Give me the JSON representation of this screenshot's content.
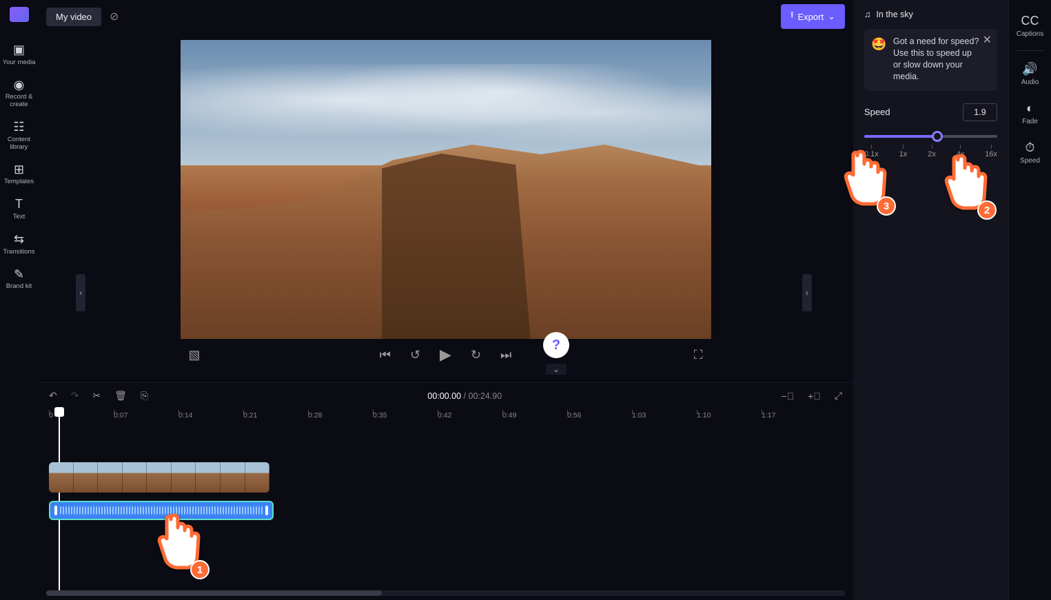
{
  "header": {
    "title": "My video",
    "export_label": "Export"
  },
  "left_nav": [
    {
      "label": "Your media"
    },
    {
      "label": "Record & create"
    },
    {
      "label": "Content library"
    },
    {
      "label": "Templates"
    },
    {
      "label": "Text"
    },
    {
      "label": "Transitions"
    },
    {
      "label": "Brand kit"
    }
  ],
  "preview": {
    "aspect_ratio": "16:9"
  },
  "transport": {
    "current_time": "00:00.00",
    "duration": "00:24.90"
  },
  "ruler_ticks": [
    "0",
    "0:07",
    "0:14",
    "0:21",
    "0:28",
    "0:35",
    "0:42",
    "0:49",
    "0:56",
    "1:03",
    "1:10",
    "1:17"
  ],
  "inspector": {
    "audio_track_title": "In the sky",
    "tip_text": "Got a need for speed? Use this to speed up or slow down your media.",
    "speed_label": "Speed",
    "speed_value": "1.9",
    "slider_marks": [
      "0.1x",
      "1x",
      "2x",
      "4x",
      "16x"
    ]
  },
  "tool_strip": [
    {
      "label": "Captions"
    },
    {
      "label": "Audio"
    },
    {
      "label": "Fade"
    },
    {
      "label": "Speed"
    }
  ],
  "tutorial": {
    "step1": "1",
    "step2": "2",
    "step3": "3"
  }
}
